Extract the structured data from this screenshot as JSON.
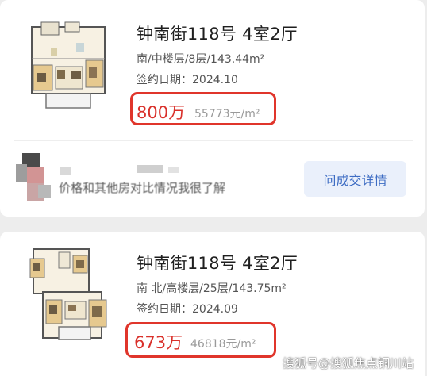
{
  "listings": [
    {
      "title": "钟南街118号 4室2厅",
      "details": "南/中楼层/8层/143.44m²",
      "sign_date": "签约日期：2024.10",
      "price": "800万",
      "unit_price": "55773元/m²",
      "agent_text": "价格和其他房对比情况我很了解",
      "ask_button": "问成交详情"
    },
    {
      "title": "钟南街118号 4室2厅",
      "details": "南 北/高楼层/25层/143.75m²",
      "sign_date": "签约日期：2024.09",
      "price": "673万",
      "unit_price": "46818元/m²"
    }
  ],
  "watermark": "搜狐号@搜狐焦点铜川站",
  "colors": {
    "price": "#d9302a",
    "highlight_border": "#e0352b",
    "button_bg": "#eaf0fb",
    "button_text": "#3d6cc3"
  }
}
